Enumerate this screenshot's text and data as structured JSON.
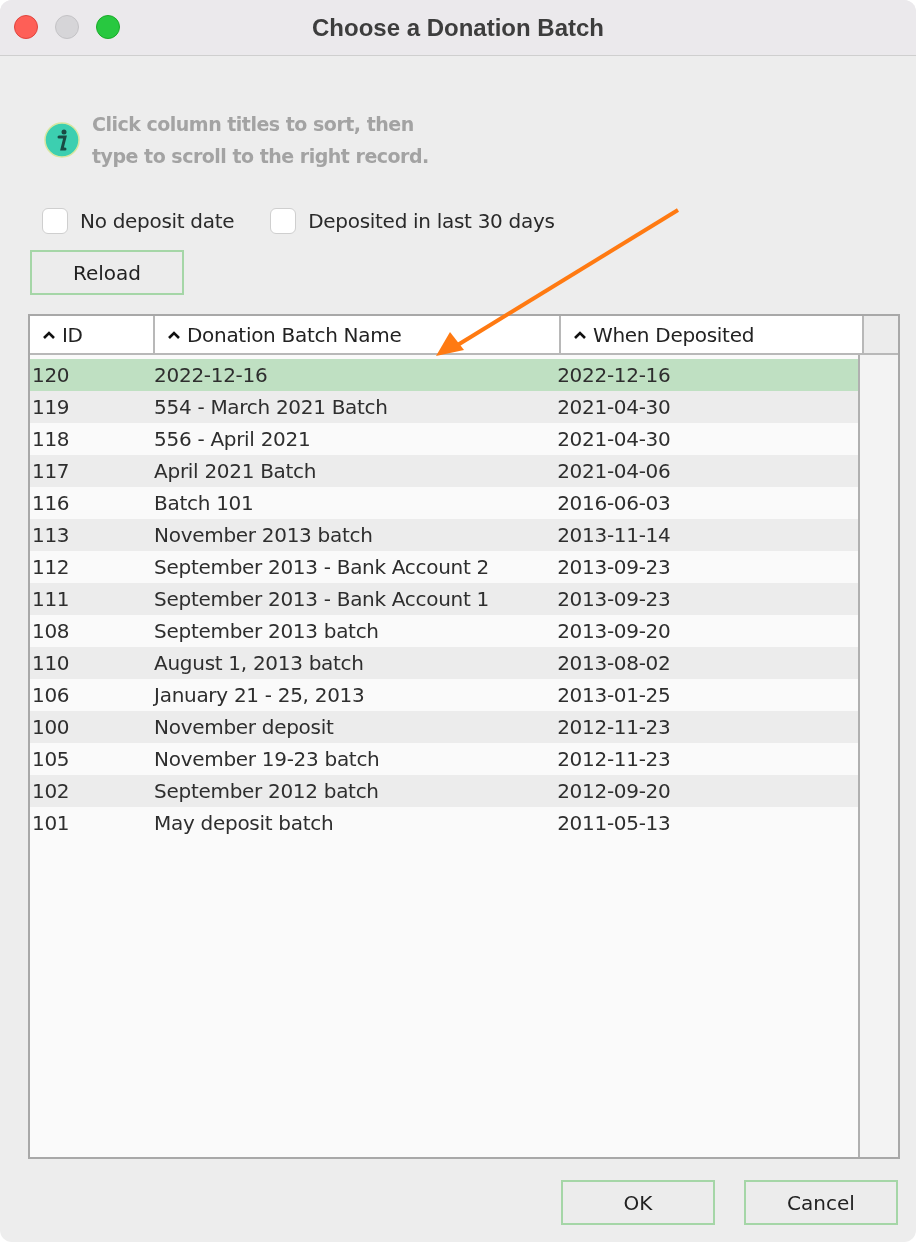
{
  "window": {
    "title": "Choose a Donation Batch"
  },
  "info": {
    "text": "Click column titles to sort, then\ntype to scroll to the right record."
  },
  "filters": [
    {
      "label": "No deposit date",
      "checked": false
    },
    {
      "label": "Deposited in last 30 days",
      "checked": false
    }
  ],
  "reload_button": "Reload",
  "table": {
    "columns": [
      {
        "label": "ID",
        "sort_ascending": true
      },
      {
        "label": "Donation Batch Name",
        "sort_ascending": true
      },
      {
        "label": "When Deposited",
        "sort_ascending": true
      }
    ],
    "rows": [
      {
        "cells": [
          "120",
          "2022-12-16",
          "2022-12-16"
        ],
        "selected": true
      },
      {
        "cells": [
          "119",
          "554 - March 2021 Batch",
          "2021-04-30"
        ],
        "selected": false
      },
      {
        "cells": [
          "118",
          "556 - April 2021",
          "2021-04-30"
        ],
        "selected": false
      },
      {
        "cells": [
          "117",
          "April 2021 Batch",
          "2021-04-06"
        ],
        "selected": false
      },
      {
        "cells": [
          "116",
          "Batch 101",
          "2016-06-03"
        ],
        "selected": false
      },
      {
        "cells": [
          "113",
          "November 2013 batch",
          "2013-11-14"
        ],
        "selected": false
      },
      {
        "cells": [
          "112",
          "September 2013 - Bank Account 2",
          "2013-09-23"
        ],
        "selected": false
      },
      {
        "cells": [
          "111",
          "September 2013 - Bank Account 1",
          "2013-09-23"
        ],
        "selected": false
      },
      {
        "cells": [
          "108",
          "September 2013 batch",
          "2013-09-20"
        ],
        "selected": false
      },
      {
        "cells": [
          "110",
          "August 1, 2013 batch",
          "2013-08-02"
        ],
        "selected": false
      },
      {
        "cells": [
          "106",
          "January 21 - 25, 2013",
          "2013-01-25"
        ],
        "selected": false
      },
      {
        "cells": [
          "100",
          "November deposit",
          "2012-11-23"
        ],
        "selected": false
      },
      {
        "cells": [
          "105",
          "November 19-23 batch",
          "2012-11-23"
        ],
        "selected": false
      },
      {
        "cells": [
          "102",
          "September 2012 batch",
          "2012-09-20"
        ],
        "selected": false
      },
      {
        "cells": [
          "101",
          "May deposit batch",
          "2011-05-13"
        ],
        "selected": false
      }
    ]
  },
  "buttons": [
    "OK",
    "Cancel"
  ]
}
